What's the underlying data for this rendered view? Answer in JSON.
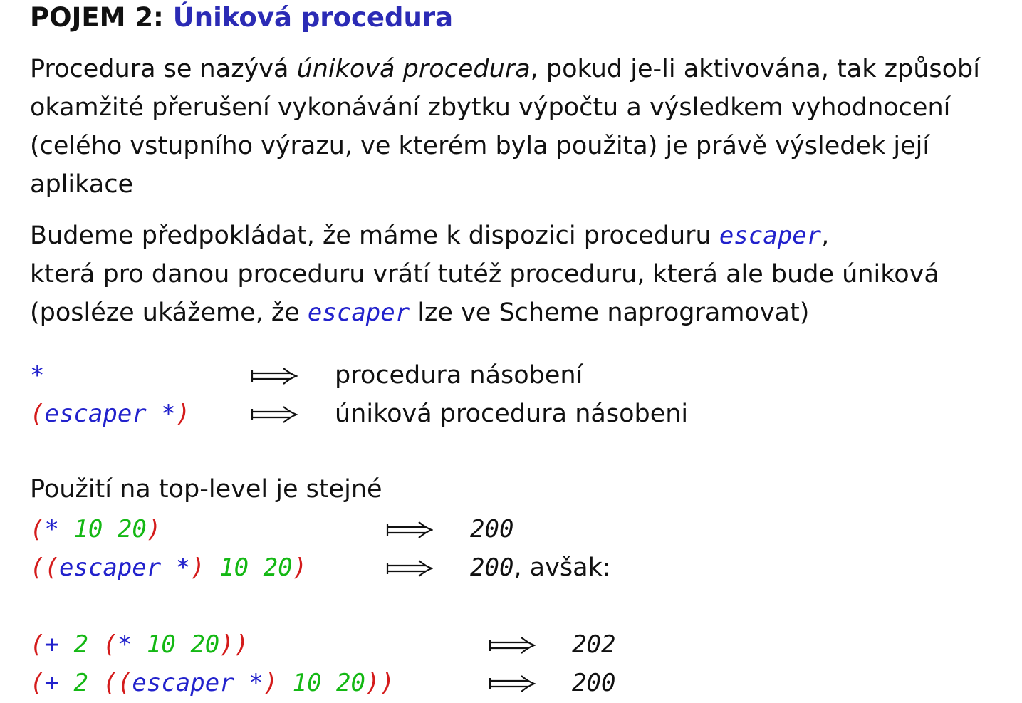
{
  "title": {
    "prefix": "POJEM 2:",
    "term": "Úniková procedura"
  },
  "para1": {
    "t1": "Procedura se nazývá ",
    "em": "úniková procedura",
    "t2": ", pokud je-li aktivována, tak způsobí okamžité přerušení vykonávání zbytku výpočtu a výsledkem vyhodnocení (celého vstupního výrazu, ve kterém byla použita) je právě výsledek její aplikace"
  },
  "para2": {
    "t1": "Budeme předpokládat, že máme k dispozici proceduru ",
    "code1": "escaper",
    "t2": ",",
    "line2": "která pro danou proceduru vrátí tutéž proceduru, která ale bude úniková",
    "t3": "(posléze ukážeme, že ",
    "code2": "escaper",
    "t4": " lze ve Scheme naprogramovat)"
  },
  "defs": [
    {
      "text": "procedura násobení"
    },
    {
      "text": "úniková procedura násobeni"
    }
  ],
  "toplevel": {
    "heading": "Použití na top-level je stejné",
    "r1_result": "200",
    "r2_result": "200",
    "r2_suffix": ", avšak:"
  },
  "nested": {
    "r1_result": "202",
    "r2_result": "200"
  },
  "tokens": {
    "open": "(",
    "close": ")",
    "close2": "))",
    "open2": "((",
    "mul": "*",
    "plus": "+",
    "escaper": "escaper",
    "n2": "2",
    "n10": "10",
    "n20": "20"
  },
  "colors": {
    "paren": "#d41b1b",
    "symbol": "#2222cc",
    "number": "#14b814",
    "title_term": "#2b2bb5"
  },
  "icons": {
    "maps_to": "long-maps-to-arrow"
  }
}
